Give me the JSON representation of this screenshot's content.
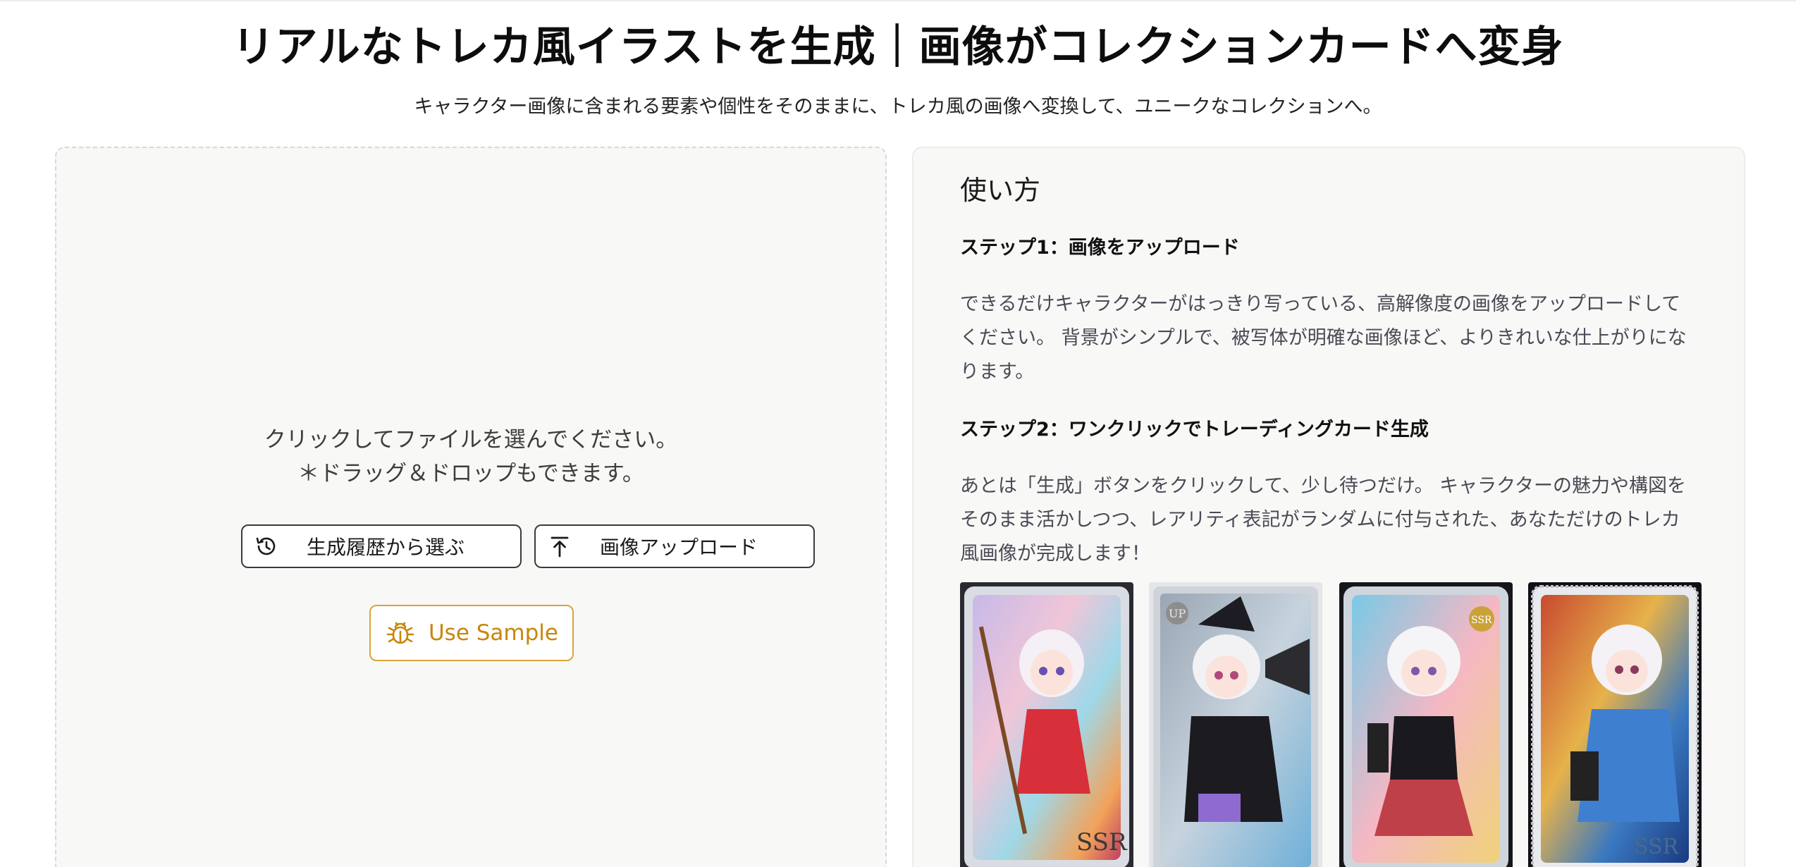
{
  "header": {
    "title": "リアルなトレカ風イラストを生成｜画像がコレクションカードへ変身",
    "subtitle": "キャラクター画像に含まれる要素や個性をそのままに、トレカ風の画像へ変換して、ユニークなコレクションへ。"
  },
  "upload": {
    "hint_line1": "クリックしてファイルを選んでください。",
    "hint_line2": "＊ドラッグ＆ドロップもできます。",
    "history_button": "生成履歴から選ぶ",
    "upload_button": "画像アップロード",
    "sample_button": "Use Sample",
    "history_icon": "history-icon",
    "upload_icon": "upload-arrow-icon",
    "sample_icon": "bug-icon",
    "accent_color": "#c8860c"
  },
  "howto": {
    "heading": "使い方",
    "step1_title": "ステップ1：画像をアップロード",
    "step1_body": "できるだけキャラクターがはっきり写っている、高解像度の画像をアップロードしてください。 背景がシンプルで、被写体が明確な画像ほど、よりきれいな仕上がりになります。",
    "step2_title": "ステップ2：ワンクリックでトレーディングカード生成",
    "step2_body": "あとは「生成」ボタンをクリックして、少し待つだけ。 キャラクターの魅力や構図をそのまま活かしつつ、レアリティ表記がランダムに付与された、あなただけのトレカ風画像が完成します！",
    "cards": [
      {
        "rarity": "SSR"
      },
      {
        "rarity": "UP"
      },
      {
        "rarity": "SSR"
      },
      {
        "rarity": "SSR"
      }
    ]
  }
}
